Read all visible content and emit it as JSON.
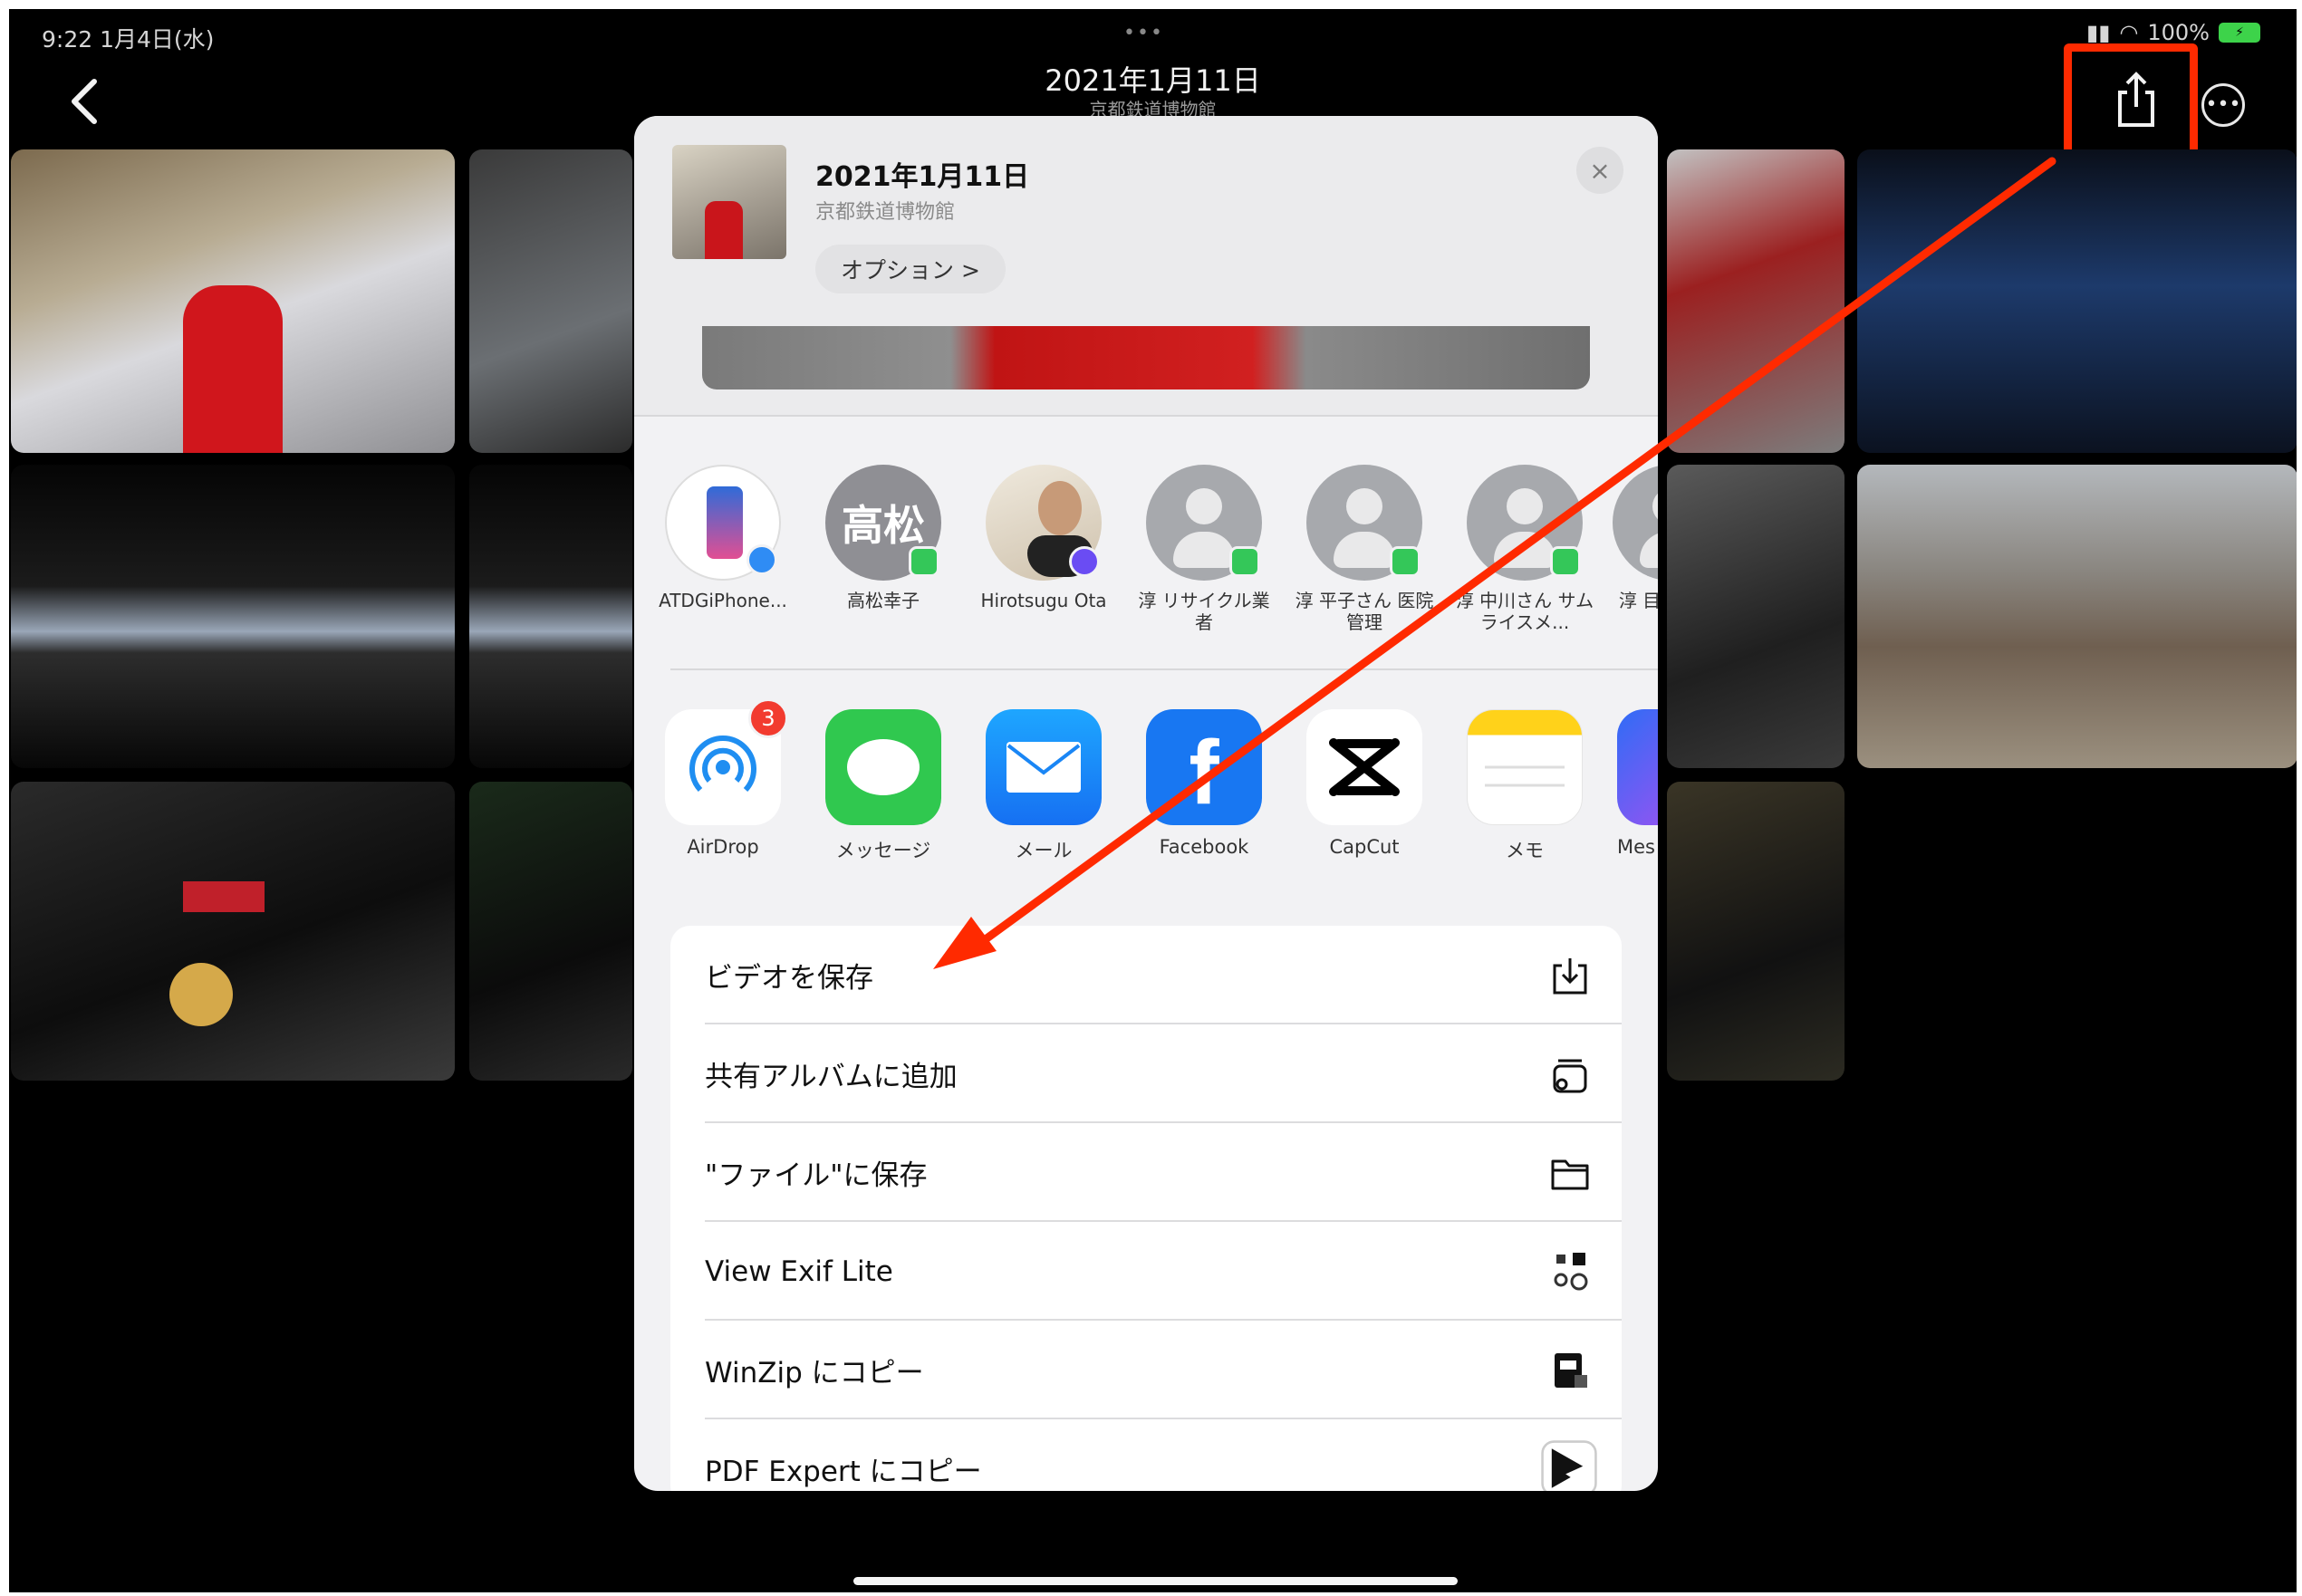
{
  "status_bar": {
    "time": "9:22 1月4日(水)",
    "battery": "100%",
    "dots": "•••"
  },
  "nav": {
    "title": "2021年1月11日",
    "subtitle": "京都鉄道博物館"
  },
  "share_sheet": {
    "header": {
      "title": "2021年1月11日",
      "subtitle": "京都鉄道博物館",
      "options_label": "オプション >",
      "close_label": "×"
    },
    "people": [
      {
        "label": "ATDGiPhone..."
      },
      {
        "label": "高松幸子",
        "initials": "高松"
      },
      {
        "label": "Hirotsugu Ota"
      },
      {
        "label": "淳 リサイクル業者"
      },
      {
        "label": "淳 平子さん 医院管理"
      },
      {
        "label": "淳 中川さん サムライスメ..."
      },
      {
        "label": "淳 目"
      }
    ],
    "apps": [
      {
        "label": "AirDrop",
        "badge": "3"
      },
      {
        "label": "メッセージ"
      },
      {
        "label": "メール"
      },
      {
        "label": "Facebook"
      },
      {
        "label": "CapCut"
      },
      {
        "label": "メモ"
      },
      {
        "label": "Mes"
      }
    ],
    "actions": [
      {
        "label": "ビデオを保存"
      },
      {
        "label": "共有アルバムに追加"
      },
      {
        "label": "\"ファイル\"に保存"
      },
      {
        "label": "View Exif Lite"
      },
      {
        "label": "WinZip にコピー"
      },
      {
        "label": "PDF Expert にコピー"
      }
    ]
  },
  "colors": {
    "highlight": "#ff2a00",
    "arrow": "#ff2a00",
    "background": "#000000",
    "sheet": "#f2f2f4"
  },
  "icons": [
    "back-chevron-icon",
    "share-icon",
    "more-icon",
    "close-icon",
    "airdrop-icon",
    "messages-icon",
    "mail-icon",
    "facebook-icon",
    "capcut-icon",
    "notes-icon",
    "messenger-icon",
    "save-video-icon",
    "shared-album-icon",
    "folder-icon",
    "exif-icon",
    "winzip-icon",
    "pdf-expert-icon"
  ]
}
